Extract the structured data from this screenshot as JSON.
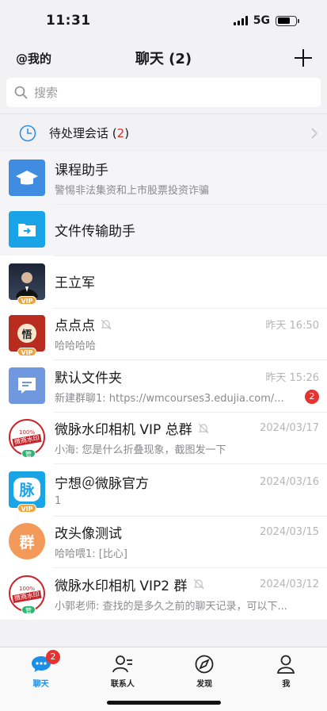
{
  "status_bar": {
    "time": "11:31",
    "network": "5G"
  },
  "header": {
    "left_label": "@我的",
    "title": "聊天 (2)"
  },
  "search": {
    "placeholder": "搜索"
  },
  "pending": {
    "label": "待处理会话",
    "count": "2",
    "open": "(",
    "close": ")"
  },
  "conversations": [
    {
      "name": "课程助手",
      "preview": "警惕非法集资和上市股票投资诈骗",
      "time": "",
      "pinned": true
    },
    {
      "name": "文件传输助手",
      "preview": "",
      "time": "",
      "pinned": true
    },
    {
      "name": "王立军",
      "preview": "",
      "time": "",
      "badge": "VIP"
    },
    {
      "name": "点点点",
      "preview": "哈哈哈哈",
      "time": "昨天 16:50",
      "badge": "VIP",
      "muted": true,
      "avatar_text": "悟"
    },
    {
      "name": "默认文件夹",
      "preview": "新建群聊1: https://wmcourses3.edujia.com/...",
      "time": "昨天 15:26",
      "unread": "2"
    },
    {
      "name": "微脉水印相机 VIP 总群",
      "preview": "小海: 您是什么折叠现象，截图发一下",
      "time": "2024/03/17",
      "badge": "管",
      "muted": true,
      "avatar_text": "微商水印",
      "avatar_small": "100%"
    },
    {
      "name": "宁想＠微脉官方",
      "preview": "1",
      "time": "2024/03/16",
      "badge": "VIP",
      "avatar_text": "脉"
    },
    {
      "name": "改头像测试",
      "preview": "哈哈喂1: [比心]",
      "time": "2024/03/15",
      "avatar_text": "群"
    },
    {
      "name": "微脉水印相机 VIP2 群",
      "preview": "小郭老师: 查找的是多久之前的聊天记录，可以下...",
      "time": "2024/03/12",
      "badge": "管",
      "muted": true,
      "avatar_text": "微商水印",
      "avatar_small": "100%"
    }
  ],
  "tabbar": {
    "tabs": [
      {
        "label": "聊天",
        "badge": "2"
      },
      {
        "label": "联系人"
      },
      {
        "label": "发现"
      },
      {
        "label": "我"
      }
    ]
  },
  "colors": {
    "accent": "#1b8fe8",
    "badge_red": "#e5342f",
    "vip_orange": "#f0a23b",
    "guan_green": "#2bb673"
  }
}
